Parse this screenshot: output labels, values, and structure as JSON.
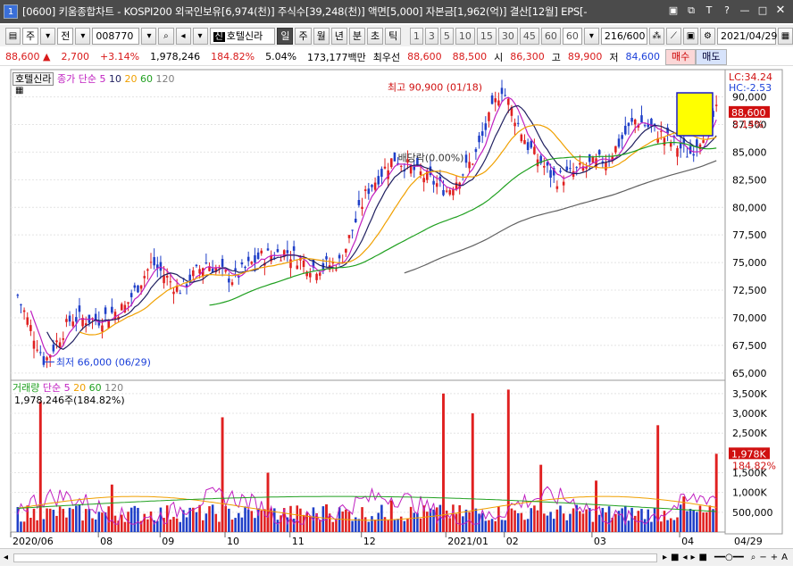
{
  "window": {
    "number": "1",
    "title": "[0600] 키움종합차트 - KOSPI200 외국인보유[6,974(천)] 주식수[39,248(천)] 액면[5,000] 자본금[1,962(억)] 결산[12월] EPS[-",
    "controls": [
      "▣",
      "⧉",
      "T",
      "?",
      "—",
      "□",
      "✕"
    ]
  },
  "toolbar": {
    "type_label": "주",
    "market_label": "전",
    "code": "008770",
    "stock_badge": "신",
    "stock_name": "호텔신라",
    "periods": [
      "일",
      "주",
      "월",
      "년",
      "분",
      "초",
      "틱"
    ],
    "minute_options": [
      "1",
      "3",
      "5",
      "10",
      "15",
      "30",
      "45",
      "60"
    ],
    "count_select": "60",
    "range": "216/600",
    "date": "2021/04/29"
  },
  "quote": {
    "price": "88,600",
    "arrow": "▲",
    "change": "2,700",
    "change_pct": "+3.14%",
    "volume": "1,978,246",
    "volume_ratio": "184.82%",
    "turnover": "5.04%",
    "amount": "173,177백만",
    "best_bid_label": "최우선",
    "best_ask": "88,600",
    "best_bid": "88,500",
    "open_label": "시",
    "open": "86,300",
    "high_label": "고",
    "high": "89,900",
    "low_label": "저",
    "low": "84,600",
    "buy_label": "매수",
    "sell_label": "매도"
  },
  "price_panel": {
    "stock_chip": "호텔신라",
    "indicator_label": "종가 단순",
    "ma_periods": [
      "5",
      "10",
      "20",
      "60",
      "120"
    ],
    "ma_colors": [
      "#c020c0",
      "#202060",
      "#f0a000",
      "#20a020",
      "#606060"
    ],
    "lc_label": "LC:34.24",
    "hc_label": "HC:-2.53",
    "current_price": "88,600",
    "current_pct": "3.14%",
    "high_annotation": "최고 90,900 (01/18)",
    "low_annotation": "최저 66,000 (06/29)",
    "dividend_annotation": "배당락(0.00%)",
    "y_ticks": [
      "90,000",
      "87,500",
      "85,000",
      "82,500",
      "80,000",
      "77,500",
      "75,000",
      "72,500",
      "70,000",
      "67,500",
      "65,000"
    ]
  },
  "volume_panel": {
    "label": "거래량",
    "indicator_label": "단순",
    "ma_periods": [
      "5",
      "20",
      "60",
      "120"
    ],
    "current_value_text": "1,978,246주(184.82%)",
    "current_tag": "1,978K",
    "current_pct": "184.82%",
    "y_ticks": [
      "3,500K",
      "3,000K",
      "2,500K",
      "2,000K",
      "1,500K",
      "1,000K",
      "500,000"
    ]
  },
  "x_axis": {
    "labels": [
      "2020/06",
      "08",
      "09",
      "10",
      "11",
      "12",
      "2021/01",
      "02",
      "03",
      "04"
    ],
    "last_date": "04/29"
  },
  "colors": {
    "up": "#e02020",
    "down": "#1f3fc8",
    "highlight_box": "#ffff00"
  },
  "chart_data": {
    "type": "candlestick",
    "series_note": "",
    "close_points": [
      [
        "2020/06",
        72000
      ],
      [
        "2020/06",
        66000
      ],
      [
        "2020/07",
        70000
      ],
      [
        "2020/07",
        69800
      ],
      [
        "2020/08",
        71000
      ],
      [
        "2020/08",
        75000
      ],
      [
        "2020/08",
        72500
      ],
      [
        "2020/09",
        75000
      ],
      [
        "2020/09",
        73500
      ],
      [
        "2020/10",
        75500
      ],
      [
        "2020/10",
        76000
      ],
      [
        "2020/10",
        74500
      ],
      [
        "2020/11",
        75000
      ],
      [
        "2020/11",
        81500
      ],
      [
        "2020/11",
        84500
      ],
      [
        "2020/12",
        83000
      ],
      [
        "2020/12",
        81500
      ],
      [
        "2021/01",
        84500
      ],
      [
        "2021/01",
        90900
      ],
      [
        "2021/01",
        85500
      ],
      [
        "2021/02",
        82500
      ],
      [
        "2021/02",
        83500
      ],
      [
        "2021/03",
        84500
      ],
      [
        "2021/03",
        88000
      ],
      [
        "2021/04",
        86500
      ],
      [
        "2021/04",
        84800
      ],
      [
        "2021/04",
        88600
      ]
    ],
    "volume_points_k": [
      [
        "2020/06",
        3300
      ],
      [
        "2020/07",
        1200
      ],
      [
        "2020/08",
        2900
      ],
      [
        "2020/08",
        1500
      ],
      [
        "2020/09",
        700
      ],
      [
        "2020/10",
        800
      ],
      [
        "2020/11",
        3500
      ],
      [
        "2020/11",
        3000
      ],
      [
        "2020/12",
        1700
      ],
      [
        "2021/01",
        3600
      ],
      [
        "2021/01",
        1300
      ],
      [
        "2021/03",
        2700
      ],
      [
        "2021/04",
        900
      ],
      [
        "2021/04",
        1978
      ]
    ],
    "ylim_price": [
      64500,
      91500
    ],
    "ylim_volume_k": [
      0,
      3700
    ],
    "grid": true
  }
}
